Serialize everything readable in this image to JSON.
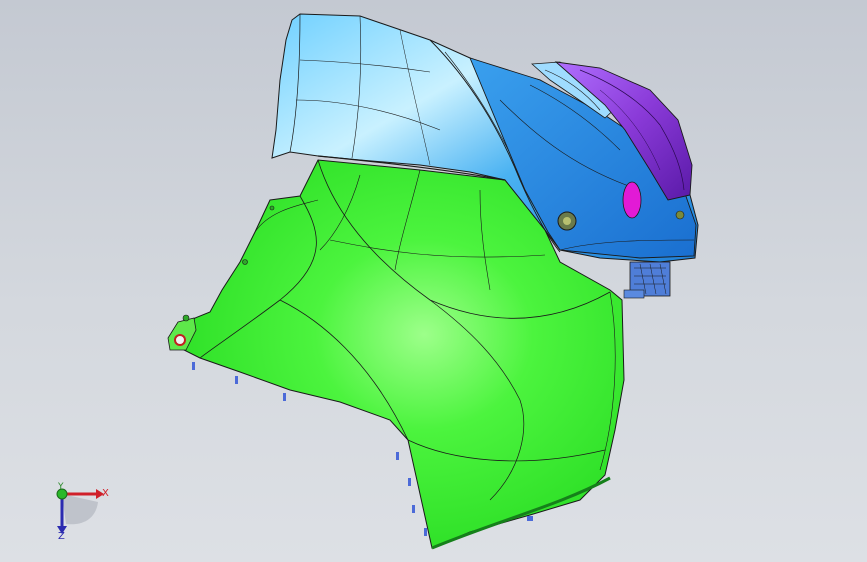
{
  "viewport": {
    "background_top": "#c4c9d2",
    "background_bottom": "#dde0e5"
  },
  "model": {
    "colors": {
      "green_panel": "#3df23a",
      "green_edge": "#1f9a1f",
      "blue_bumper": "#3aa8f0",
      "blue_light": "#bfeaff",
      "purple_lamp": "#8a3ad8",
      "magenta_spot": "#e21ad6",
      "edge_line": "#1a1a1a"
    }
  },
  "triad": {
    "x_label": "X",
    "y_label": "Y",
    "z_label": "Z",
    "x_color": "#d0202a",
    "y_color": "#2a8a2a",
    "z_color": "#2b2bb0"
  }
}
